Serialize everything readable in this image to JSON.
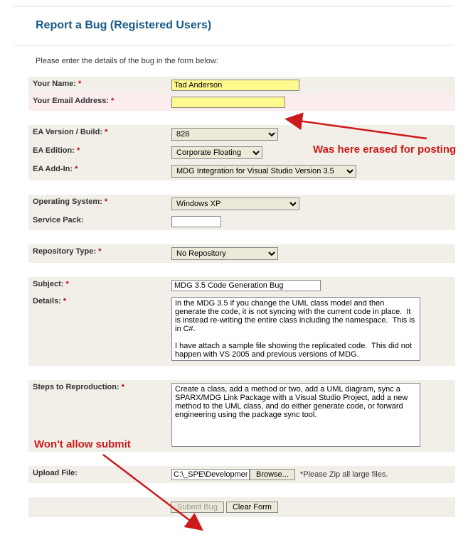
{
  "title": "Report a Bug (Registered Users)",
  "intro": "Please enter the details of the bug in the form below:",
  "labels": {
    "name": "Your Name:",
    "email": "Your Email Address:",
    "version": "EA Version / Build:",
    "edition": "EA Edition:",
    "addin": "EA Add-In:",
    "os": "Operating System:",
    "sp": "Service Pack:",
    "repo": "Repository Type:",
    "subject": "Subject:",
    "details": "Details:",
    "steps": "Steps to Reproduction:",
    "upload": "Upload File:"
  },
  "req_marker": "*",
  "values": {
    "name": "Tad Anderson",
    "email": "",
    "version": "828",
    "edition": "Corporate Floating",
    "addin": "MDG Integration for Visual Studio Version 3.5",
    "os": "Windows XP",
    "sp": "",
    "repo": "No Repository",
    "subject": "MDG 3.5 Code Generation Bug",
    "details": "In the MDG 3.5 if you change the UML class model and then generate the code, it is not syncing with the current code in place.  It is instead re-writing the entire class including the namespace.  This is in C#.\n\nI have attach a sample file showing the replicated code.  This did not happen with VS 2005 and previous versions of MDG.",
    "steps": "Create a class, add a method or two, add a UML diagram, sync a SPARX/MDG Link Package with a Visual Studio Project, add a new method to the UML class, and do either generate code, or forward engineering using the package sync tool.",
    "upload_path": "C:\\_SPE\\Developmen"
  },
  "file_note": "*Please Zip all large files.",
  "buttons": {
    "browse": "Browse...",
    "submit": "Submit Bug",
    "clear": "Clear Form"
  },
  "annotations": {
    "erased": "Was here erased for posting",
    "wont_submit": "Won't allow submit"
  }
}
